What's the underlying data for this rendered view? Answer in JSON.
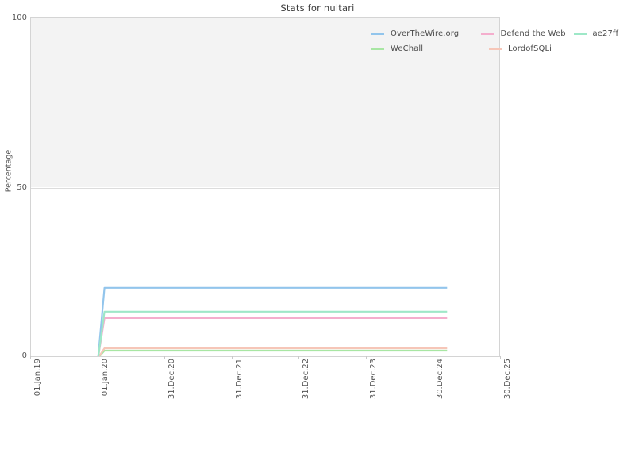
{
  "chart_data": {
    "type": "line",
    "title": "Stats for nultari",
    "xlabel": "",
    "ylabel": "Percentage",
    "ylim": [
      0,
      100
    ],
    "yticks": [
      0,
      50,
      100
    ],
    "grid": true,
    "legend_position": "top-right",
    "x_tick_labels": [
      "01.Jan.19",
      "01.Jan.20",
      "31.Dec.20",
      "31.Dec.21",
      "31.Dec.22",
      "31.Dec.23",
      "30.Dec.24",
      "30.Dec.25"
    ],
    "x": [
      "01.Jan.20",
      "01.Apr.20",
      "30.Dec.24"
    ],
    "series": [
      {
        "name": "OverTheWire.org",
        "color": "#92c5ec",
        "values": [
          0,
          20.6,
          20.6
        ]
      },
      {
        "name": "WeChall",
        "color": "#a8e6a3",
        "values": [
          0,
          2.1,
          2.1
        ]
      },
      {
        "name": "Defend the Web",
        "color": "#f4aecd",
        "values": [
          0,
          11.7,
          11.7
        ]
      },
      {
        "name": "LordofSQLi",
        "color": "#f6c6b8",
        "values": [
          0,
          2.8,
          2.8
        ]
      },
      {
        "name": "ae27ff",
        "color": "#9ee8c8",
        "values": [
          0,
          13.6,
          13.6
        ]
      }
    ]
  },
  "legend": {
    "rows": [
      [
        {
          "label": "OverTheWire.org",
          "color": "#92c5ec"
        },
        {
          "label": "Defend the Web",
          "color": "#f4aecd"
        },
        {
          "label": "ae27ff",
          "color": "#9ee8c8"
        }
      ],
      [
        {
          "label": "WeChall",
          "color": "#a8e6a3"
        },
        {
          "label": "LordofSQLi",
          "color": "#f6c6b8"
        }
      ]
    ]
  },
  "axes": {
    "y_labels": [
      "100",
      "50",
      "0"
    ],
    "y_title": "Percentage"
  }
}
